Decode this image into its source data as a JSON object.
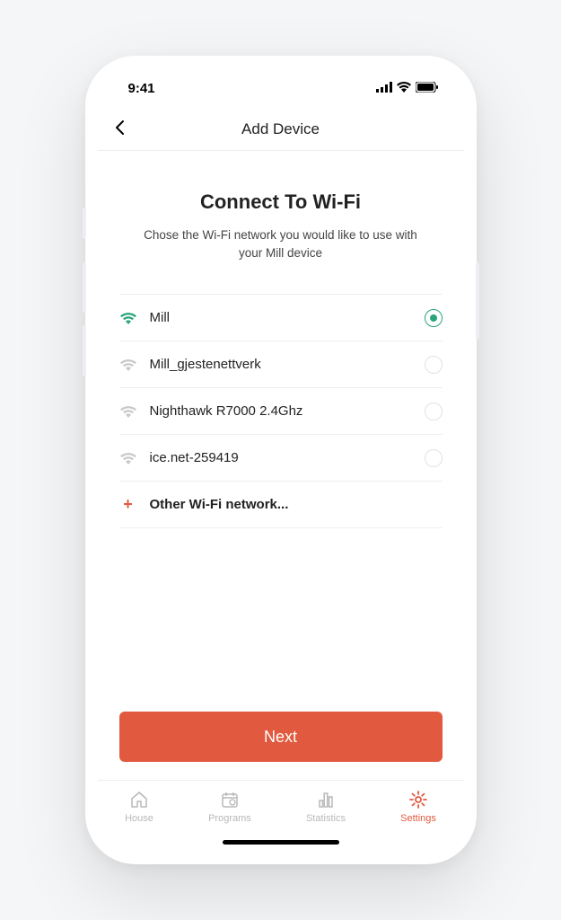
{
  "statusbar": {
    "time": "9:41"
  },
  "navbar": {
    "title": "Add Device"
  },
  "main": {
    "heading": "Connect To Wi-Fi",
    "subtitle": "Chose the Wi-Fi network you would like   to use with your Mill device"
  },
  "networks": [
    {
      "ssid": "Mill",
      "selected": true
    },
    {
      "ssid": "Mill_gjestenettverk",
      "selected": false
    },
    {
      "ssid": "Nighthawk R7000 2.4Ghz",
      "selected": false
    },
    {
      "ssid": "ice.net-259419",
      "selected": false
    }
  ],
  "other_network_label": "Other Wi-Fi network...",
  "next_button": "Next",
  "tabs": [
    {
      "label": "House"
    },
    {
      "label": "Programs"
    },
    {
      "label": "Statistics"
    },
    {
      "label": "Settings"
    }
  ],
  "colors": {
    "accent": "#e15a3f",
    "selected": "#2aa57b"
  }
}
